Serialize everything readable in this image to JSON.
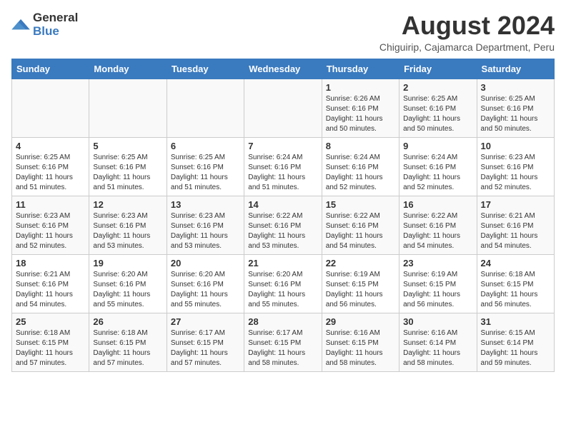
{
  "header": {
    "logo": {
      "general": "General",
      "blue": "Blue"
    },
    "title": "August 2024",
    "location": "Chiguirip, Cajamarca Department, Peru"
  },
  "calendar": {
    "days_of_week": [
      "Sunday",
      "Monday",
      "Tuesday",
      "Wednesday",
      "Thursday",
      "Friday",
      "Saturday"
    ],
    "weeks": [
      [
        {
          "day": "",
          "info": ""
        },
        {
          "day": "",
          "info": ""
        },
        {
          "day": "",
          "info": ""
        },
        {
          "day": "",
          "info": ""
        },
        {
          "day": "1",
          "sunrise": "6:26 AM",
          "sunset": "6:16 PM",
          "daylight": "11 hours and 50 minutes."
        },
        {
          "day": "2",
          "sunrise": "6:25 AM",
          "sunset": "6:16 PM",
          "daylight": "11 hours and 50 minutes."
        },
        {
          "day": "3",
          "sunrise": "6:25 AM",
          "sunset": "6:16 PM",
          "daylight": "11 hours and 50 minutes."
        }
      ],
      [
        {
          "day": "4",
          "sunrise": "6:25 AM",
          "sunset": "6:16 PM",
          "daylight": "11 hours and 51 minutes."
        },
        {
          "day": "5",
          "sunrise": "6:25 AM",
          "sunset": "6:16 PM",
          "daylight": "11 hours and 51 minutes."
        },
        {
          "day": "6",
          "sunrise": "6:25 AM",
          "sunset": "6:16 PM",
          "daylight": "11 hours and 51 minutes."
        },
        {
          "day": "7",
          "sunrise": "6:24 AM",
          "sunset": "6:16 PM",
          "daylight": "11 hours and 51 minutes."
        },
        {
          "day": "8",
          "sunrise": "6:24 AM",
          "sunset": "6:16 PM",
          "daylight": "11 hours and 52 minutes."
        },
        {
          "day": "9",
          "sunrise": "6:24 AM",
          "sunset": "6:16 PM",
          "daylight": "11 hours and 52 minutes."
        },
        {
          "day": "10",
          "sunrise": "6:23 AM",
          "sunset": "6:16 PM",
          "daylight": "11 hours and 52 minutes."
        }
      ],
      [
        {
          "day": "11",
          "sunrise": "6:23 AM",
          "sunset": "6:16 PM",
          "daylight": "11 hours and 52 minutes."
        },
        {
          "day": "12",
          "sunrise": "6:23 AM",
          "sunset": "6:16 PM",
          "daylight": "11 hours and 53 minutes."
        },
        {
          "day": "13",
          "sunrise": "6:23 AM",
          "sunset": "6:16 PM",
          "daylight": "11 hours and 53 minutes."
        },
        {
          "day": "14",
          "sunrise": "6:22 AM",
          "sunset": "6:16 PM",
          "daylight": "11 hours and 53 minutes."
        },
        {
          "day": "15",
          "sunrise": "6:22 AM",
          "sunset": "6:16 PM",
          "daylight": "11 hours and 54 minutes."
        },
        {
          "day": "16",
          "sunrise": "6:22 AM",
          "sunset": "6:16 PM",
          "daylight": "11 hours and 54 minutes."
        },
        {
          "day": "17",
          "sunrise": "6:21 AM",
          "sunset": "6:16 PM",
          "daylight": "11 hours and 54 minutes."
        }
      ],
      [
        {
          "day": "18",
          "sunrise": "6:21 AM",
          "sunset": "6:16 PM",
          "daylight": "11 hours and 54 minutes."
        },
        {
          "day": "19",
          "sunrise": "6:20 AM",
          "sunset": "6:16 PM",
          "daylight": "11 hours and 55 minutes."
        },
        {
          "day": "20",
          "sunrise": "6:20 AM",
          "sunset": "6:16 PM",
          "daylight": "11 hours and 55 minutes."
        },
        {
          "day": "21",
          "sunrise": "6:20 AM",
          "sunset": "6:16 PM",
          "daylight": "11 hours and 55 minutes."
        },
        {
          "day": "22",
          "sunrise": "6:19 AM",
          "sunset": "6:15 PM",
          "daylight": "11 hours and 56 minutes."
        },
        {
          "day": "23",
          "sunrise": "6:19 AM",
          "sunset": "6:15 PM",
          "daylight": "11 hours and 56 minutes."
        },
        {
          "day": "24",
          "sunrise": "6:18 AM",
          "sunset": "6:15 PM",
          "daylight": "11 hours and 56 minutes."
        }
      ],
      [
        {
          "day": "25",
          "sunrise": "6:18 AM",
          "sunset": "6:15 PM",
          "daylight": "11 hours and 57 minutes."
        },
        {
          "day": "26",
          "sunrise": "6:18 AM",
          "sunset": "6:15 PM",
          "daylight": "11 hours and 57 minutes."
        },
        {
          "day": "27",
          "sunrise": "6:17 AM",
          "sunset": "6:15 PM",
          "daylight": "11 hours and 57 minutes."
        },
        {
          "day": "28",
          "sunrise": "6:17 AM",
          "sunset": "6:15 PM",
          "daylight": "11 hours and 58 minutes."
        },
        {
          "day": "29",
          "sunrise": "6:16 AM",
          "sunset": "6:15 PM",
          "daylight": "11 hours and 58 minutes."
        },
        {
          "day": "30",
          "sunrise": "6:16 AM",
          "sunset": "6:14 PM",
          "daylight": "11 hours and 58 minutes."
        },
        {
          "day": "31",
          "sunrise": "6:15 AM",
          "sunset": "6:14 PM",
          "daylight": "11 hours and 59 minutes."
        }
      ]
    ]
  }
}
